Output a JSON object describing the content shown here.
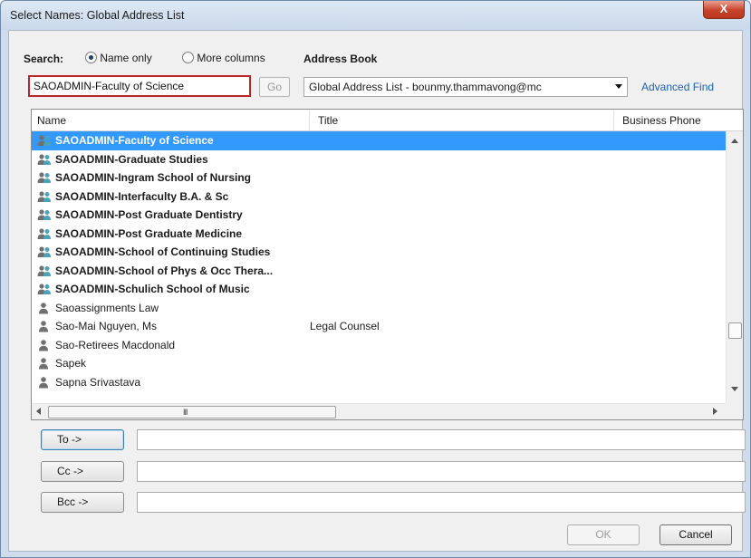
{
  "window": {
    "title": "Select Names: Global Address List",
    "close_label": "X"
  },
  "search": {
    "label": "Search:",
    "option_name_only": "Name only",
    "option_more_columns": "More columns",
    "selected_option": "Name only",
    "value": "SAOADMIN-Faculty of Science",
    "go_label": "Go"
  },
  "address_book": {
    "label": "Address Book",
    "value": "Global Address List - bounmy.thammavong@mc",
    "advanced_find": "Advanced Find"
  },
  "list": {
    "columns": [
      "Name",
      "Title",
      "Business Phone"
    ],
    "rows": [
      {
        "name": "SAOADMIN-Faculty of Science",
        "title": "",
        "kind": "group",
        "selected": true
      },
      {
        "name": "SAOADMIN-Graduate Studies",
        "title": "",
        "kind": "group"
      },
      {
        "name": "SAOADMIN-Ingram School of Nursing",
        "title": "",
        "kind": "group"
      },
      {
        "name": "SAOADMIN-Interfaculty B.A. & Sc",
        "title": "",
        "kind": "group"
      },
      {
        "name": "SAOADMIN-Post Graduate Dentistry",
        "title": "",
        "kind": "group"
      },
      {
        "name": "SAOADMIN-Post Graduate Medicine",
        "title": "",
        "kind": "group"
      },
      {
        "name": "SAOADMIN-School of Continuing Studies",
        "title": "",
        "kind": "group"
      },
      {
        "name": "SAOADMIN-School of Phys & Occ Thera...",
        "title": "",
        "kind": "group"
      },
      {
        "name": "SAOADMIN-Schulich School of Music",
        "title": "",
        "kind": "group"
      },
      {
        "name": "Saoassignments Law",
        "title": "",
        "kind": "person"
      },
      {
        "name": "Sao-Mai Nguyen, Ms",
        "title": "Legal Counsel",
        "kind": "person"
      },
      {
        "name": "Sao-Retirees Macdonald",
        "title": "",
        "kind": "person"
      },
      {
        "name": "Sapek",
        "title": "",
        "kind": "person"
      },
      {
        "name": "Sapna Srivastava",
        "title": "",
        "kind": "person"
      }
    ],
    "hscroll_grip": "III"
  },
  "recipients": {
    "to_label": "To ->",
    "cc_label": "Cc ->",
    "bcc_label": "Bcc ->"
  },
  "buttons": {
    "ok": "OK",
    "cancel": "Cancel"
  },
  "colors": {
    "selection": "#3399ff",
    "link": "#1a5fb4",
    "search_highlight": "#b8262a",
    "group_icon": "#4aa3b8",
    "person_icon": "#707070"
  }
}
